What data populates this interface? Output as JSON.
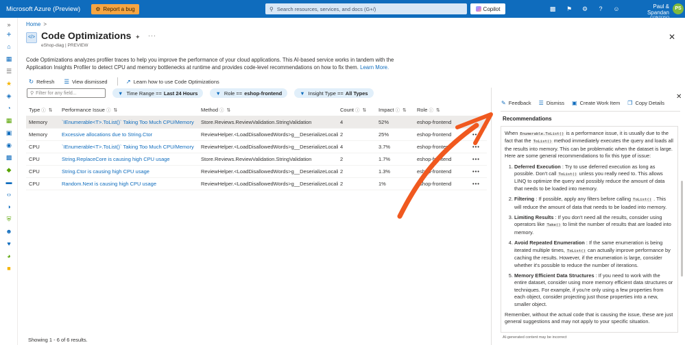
{
  "topbar": {
    "brand": "Microsoft Azure (Preview)",
    "report_bug": "Report a bug",
    "search_placeholder": "Search resources, services, and docs (G+/)",
    "copilot": "Copilot",
    "user_name": "Paul & Spandan",
    "user_org": "CONTOSO",
    "user_initials": "PS"
  },
  "breadcrumb": {
    "home": "Home",
    "sep": ">"
  },
  "page": {
    "title": "Code Optimizations",
    "subtitle": "eShop-diag | PREVIEW",
    "description": "Code Optimizations analyzes profiler traces to help you improve the performance of your cloud applications. This AI-based service works in tandem with the Application Insights Profiler to detect CPU and memory bottlenecks at runtime and provides code-level recommendations on how to fix them.",
    "learn_more": "Learn More."
  },
  "toolbar": {
    "refresh": "Refresh",
    "view_dismissed": "View dismissed",
    "learn_how": "Learn how to use Code Optimizations"
  },
  "filters": {
    "placeholder": "Filter for any field...",
    "time_range": {
      "label": "Time Range ==",
      "value": "Last 24 Hours"
    },
    "role": {
      "label": "Role ==",
      "value": "eshop-frontend"
    },
    "insight_type": {
      "label": "Insight Type ==",
      "value": "All Types"
    }
  },
  "grid": {
    "headers": {
      "type": "Type",
      "issue": "Performance Issue",
      "method": "Method",
      "count": "Count",
      "impact": "Impact",
      "role": "Role"
    },
    "rows": [
      {
        "type": "Memory",
        "issue": "`IEnumerable<T>.ToList()` Taking Too Much CPU/Memory",
        "method": "Store.Reviews.ReviewValidation.StringValidation",
        "count": "4",
        "impact": "52%",
        "role": "eshop-frontend",
        "more": "",
        "selected": true
      },
      {
        "type": "Memory",
        "issue": "Excessive allocations due to String.Ctor",
        "method": "ReviewHelper.<LoadDisallowedWords>g__DeserializeLocalize",
        "count": "2",
        "impact": "25%",
        "role": "eshop-frontend",
        "more": "•••",
        "selected": false
      },
      {
        "type": "CPU",
        "issue": "`IEnumerable<T>.ToList()` Taking Too Much CPU/Memory",
        "method": "ReviewHelper.<LoadDisallowedWords>g__DeserializeLocalize",
        "count": "4",
        "impact": "3.7%",
        "role": "eshop-frontend",
        "more": "•••",
        "selected": false
      },
      {
        "type": "CPU",
        "issue": "String.ReplaceCore is causing high CPU usage",
        "method": "Store.Reviews.ReviewValidation.StringValidation",
        "count": "2",
        "impact": "1.7%",
        "role": "eshop-frontend",
        "more": "•••",
        "selected": false
      },
      {
        "type": "CPU",
        "issue": "String.Ctor is causing high CPU usage",
        "method": "ReviewHelper.<LoadDisallowedWords>g__DeserializeLocalize",
        "count": "2",
        "impact": "1.3%",
        "role": "eshop-frontend",
        "more": "•••",
        "selected": false
      },
      {
        "type": "CPU",
        "issue": "Random.Next is causing high CPU usage",
        "method": "ReviewHelper.<LoadDisallowedWords>g__DeserializeLocalize",
        "count": "2",
        "impact": "1%",
        "role": "eshop-frontend",
        "more": "•••",
        "selected": false
      }
    ],
    "footer": "Showing 1 - 6 of 6 results."
  },
  "panel": {
    "actions": {
      "feedback": "Feedback",
      "dismiss": "Dismiss",
      "work_item": "Create Work Item",
      "copy": "Copy Details"
    },
    "title": "Recommendations",
    "intro_1": "When",
    "intro_code": "Enumerable.ToList()",
    "intro_2": "is a performance issue, it is usually due to the fact that the",
    "intro_code2": "ToList()",
    "intro_3": "method immediately executes the query and loads all the results into memory. This can be problematic when the dataset is large. Here are some general recommendations to fix this type of issue:",
    "items": [
      {
        "title": "Deferred Execution",
        "text_a": ": Try to use deferred execution as long as possible. Don't call",
        "code": "ToList()",
        "text_b": "unless you really need to. This allows LINQ to optimize the query and possibly reduce the amount of data that needs to be loaded into memory."
      },
      {
        "title": "Filtering",
        "text_a": ": If possible, apply any filters before calling",
        "code": "ToList()",
        "text_b": ". This will reduce the amount of data that needs to be loaded into memory."
      },
      {
        "title": "Limiting Results",
        "text_a": ": If you don't need all the results, consider using operators like",
        "code": "Take()",
        "text_b": "to limit the number of results that are loaded into memory."
      },
      {
        "title": "Avoid Repeated Enumeration",
        "text_a": ": If the same enumeration is being iterated multiple times,",
        "code": "ToList()",
        "text_b": "can actually improve performance by caching the results. However, if the enumeration is large, consider whether it's possible to reduce the number of iterations."
      },
      {
        "title": "Memory Efficient Data Structures",
        "text_a": ": If you need to work with the entire dataset, consider using more memory efficient data structures or techniques. For example, if you're only using a few properties from each object, consider projecting just those properties into a new, smaller object.",
        "code": "",
        "text_b": ""
      }
    ],
    "closing": "Remember, without the actual code that is causing the issue, these are just general suggestions and may not apply to your specific situation.",
    "ai_note": "AI-generated content may be incorrect"
  },
  "colors": {
    "accent": "#0f6cbd",
    "annotation_arrow": "#f0591f",
    "bug_button": "#f7a541",
    "avatar": "#7fb93d"
  }
}
